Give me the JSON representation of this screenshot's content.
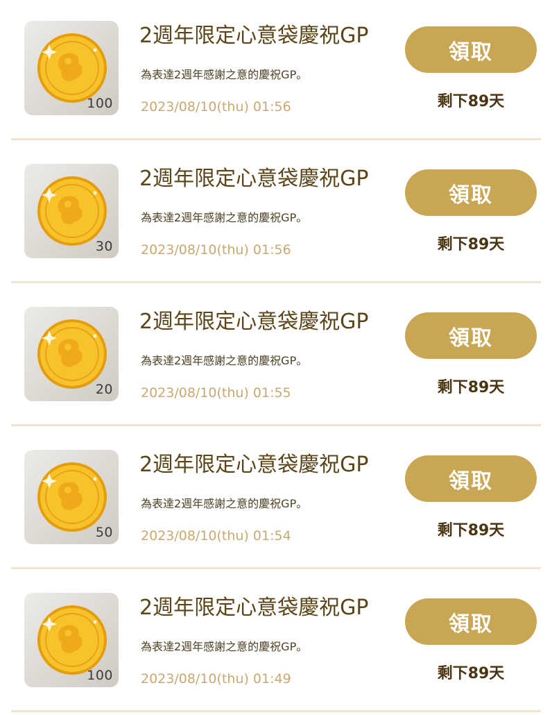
{
  "colors": {
    "button": "#c9a653",
    "title": "#5b4517",
    "date": "#c9a870",
    "divider": "#efe3d2",
    "coin": "#f4b41f"
  },
  "items": [
    {
      "icon": "gold-coin-icon",
      "amount": "100",
      "title": "2週年限定心意袋慶祝GP",
      "description": "為表達2週年感謝之意的慶祝GP。",
      "date": "2023/08/10(thu) 01:56",
      "button_label": "領取",
      "remaining": "剩下89天"
    },
    {
      "icon": "gold-coin-icon",
      "amount": "30",
      "title": "2週年限定心意袋慶祝GP",
      "description": "為表達2週年感謝之意的慶祝GP。",
      "date": "2023/08/10(thu) 01:56",
      "button_label": "領取",
      "remaining": "剩下89天"
    },
    {
      "icon": "gold-coin-icon",
      "amount": "20",
      "title": "2週年限定心意袋慶祝GP",
      "description": "為表達2週年感謝之意的慶祝GP。",
      "date": "2023/08/10(thu) 01:55",
      "button_label": "領取",
      "remaining": "剩下89天"
    },
    {
      "icon": "gold-coin-icon",
      "amount": "50",
      "title": "2週年限定心意袋慶祝GP",
      "description": "為表達2週年感謝之意的慶祝GP。",
      "date": "2023/08/10(thu) 01:54",
      "button_label": "領取",
      "remaining": "剩下89天"
    },
    {
      "icon": "gold-coin-icon",
      "amount": "100",
      "title": "2週年限定心意袋慶祝GP",
      "description": "為表達2週年感謝之意的慶祝GP。",
      "date": "2023/08/10(thu) 01:49",
      "button_label": "領取",
      "remaining": "剩下89天"
    }
  ]
}
